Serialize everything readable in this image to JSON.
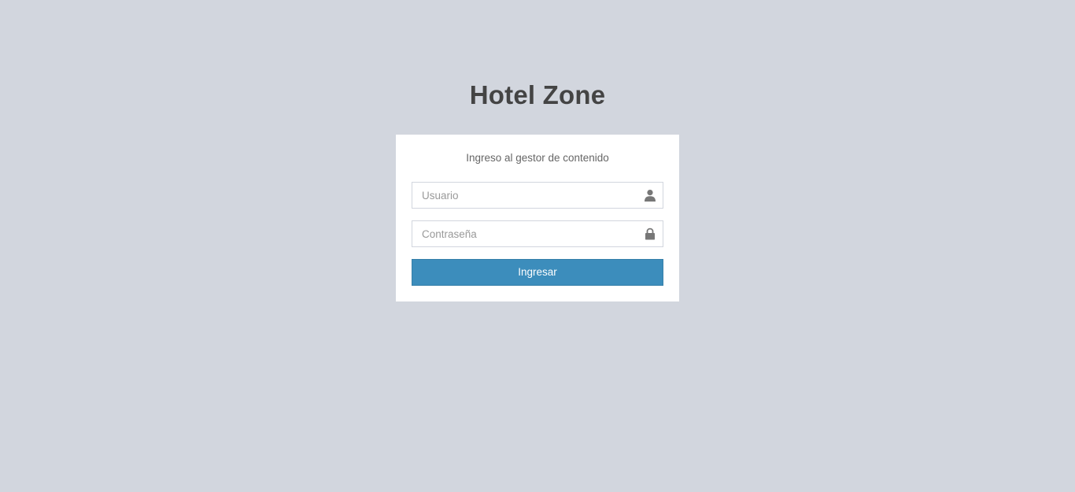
{
  "app": {
    "title": "Hotel Zone"
  },
  "login": {
    "message": "Ingreso al gestor de contenido",
    "username": {
      "placeholder": "Usuario",
      "value": "",
      "icon": "user-icon"
    },
    "password": {
      "placeholder": "Contraseña",
      "value": "",
      "icon": "lock-icon"
    },
    "submit_label": "Ingresar"
  },
  "colors": {
    "background": "#d2d6de",
    "card": "#ffffff",
    "primary": "#3c8dbc",
    "primary_border": "#367fa9",
    "title_text": "#444444",
    "icon": "#777777"
  }
}
